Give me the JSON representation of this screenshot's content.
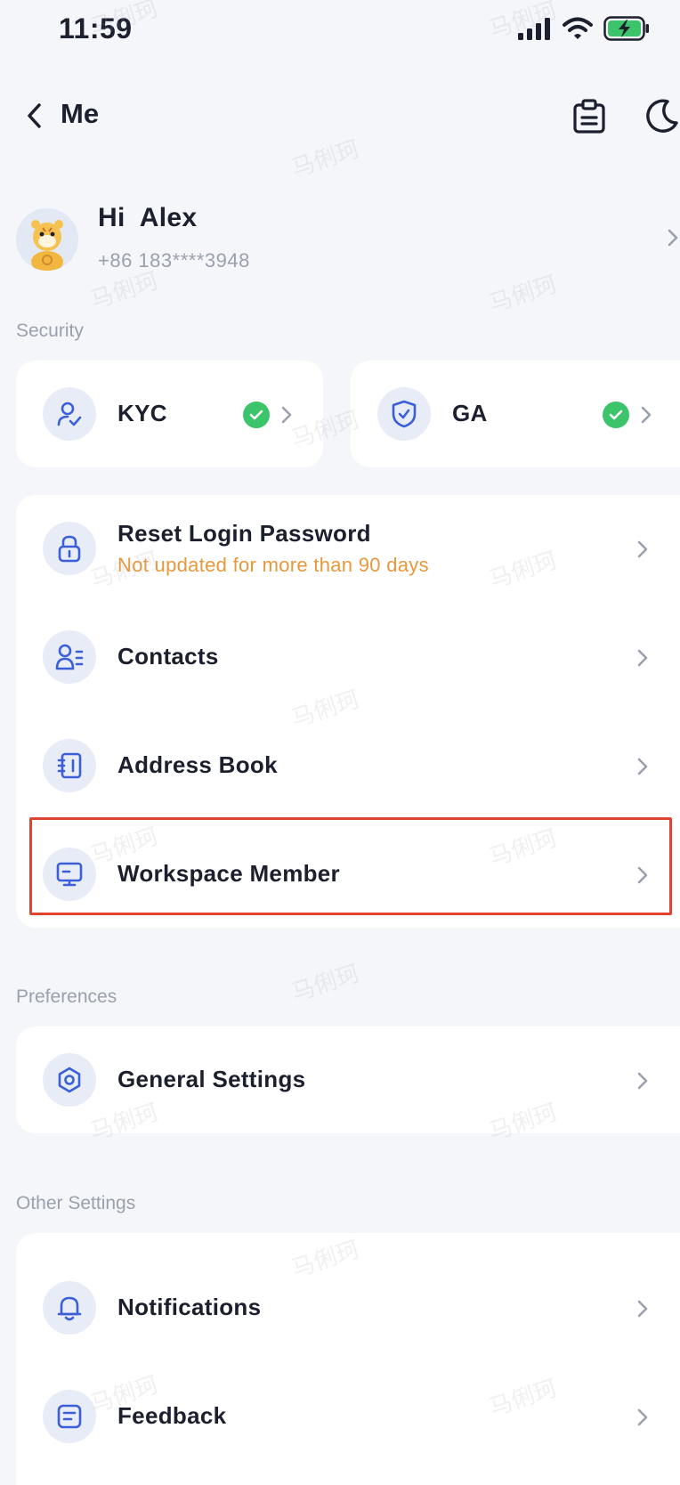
{
  "status_bar": {
    "time": "11:59"
  },
  "nav": {
    "title": "Me"
  },
  "profile": {
    "greeting": "Hi  Alex",
    "phone": "+86 183****3948"
  },
  "sections": {
    "security": "Security",
    "preferences": "Preferences",
    "other": "Other Settings"
  },
  "security_cards": [
    {
      "label": "KYC",
      "verified": true
    },
    {
      "label": "GA",
      "verified": true
    }
  ],
  "account_items": [
    {
      "label": "Reset Login Password",
      "sublabel": "Not updated for more than 90 days"
    },
    {
      "label": "Contacts"
    },
    {
      "label": "Address Book"
    },
    {
      "label": "Workspace Member"
    }
  ],
  "preference_items": [
    {
      "label": "General Settings"
    }
  ],
  "other_items": [
    {
      "label": "Notifications"
    },
    {
      "label": "Feedback"
    }
  ],
  "watermark": "马俐珂",
  "colors": {
    "accent": "#3b5fd9",
    "icon_bg": "#e7ecf7",
    "warning": "#e8973a",
    "success": "#3cc46b",
    "highlight": "#e0432f"
  }
}
